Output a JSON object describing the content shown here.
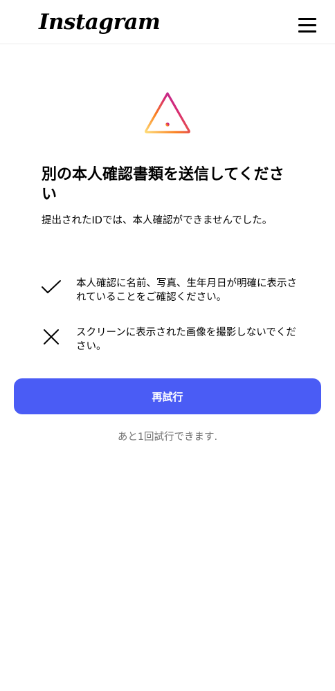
{
  "header": {
    "logo_text": "Instagram",
    "menu_icon": "hamburger-menu-icon"
  },
  "alert": {
    "icon": "warning-triangle-icon",
    "gradient_colors": [
      "#feda75",
      "#fa7e1e",
      "#d62976",
      "#962fbf"
    ],
    "title": "別の本人確認書類を送信してください",
    "subtitle": "提出されたIDでは、本人確認ができませんでした。"
  },
  "tips": [
    {
      "icon": "checkmark-icon",
      "text": "本人確認に名前、写真、生年月日が明確に表示されていることをご確認ください。"
    },
    {
      "icon": "x-mark-icon",
      "text": "スクリーンに表示された画像を撮影しないでください。"
    }
  ],
  "actions": {
    "retry_label": "再試行",
    "retry_color": "#4a5cf5",
    "attempts_text": "あと1回試行できます."
  }
}
